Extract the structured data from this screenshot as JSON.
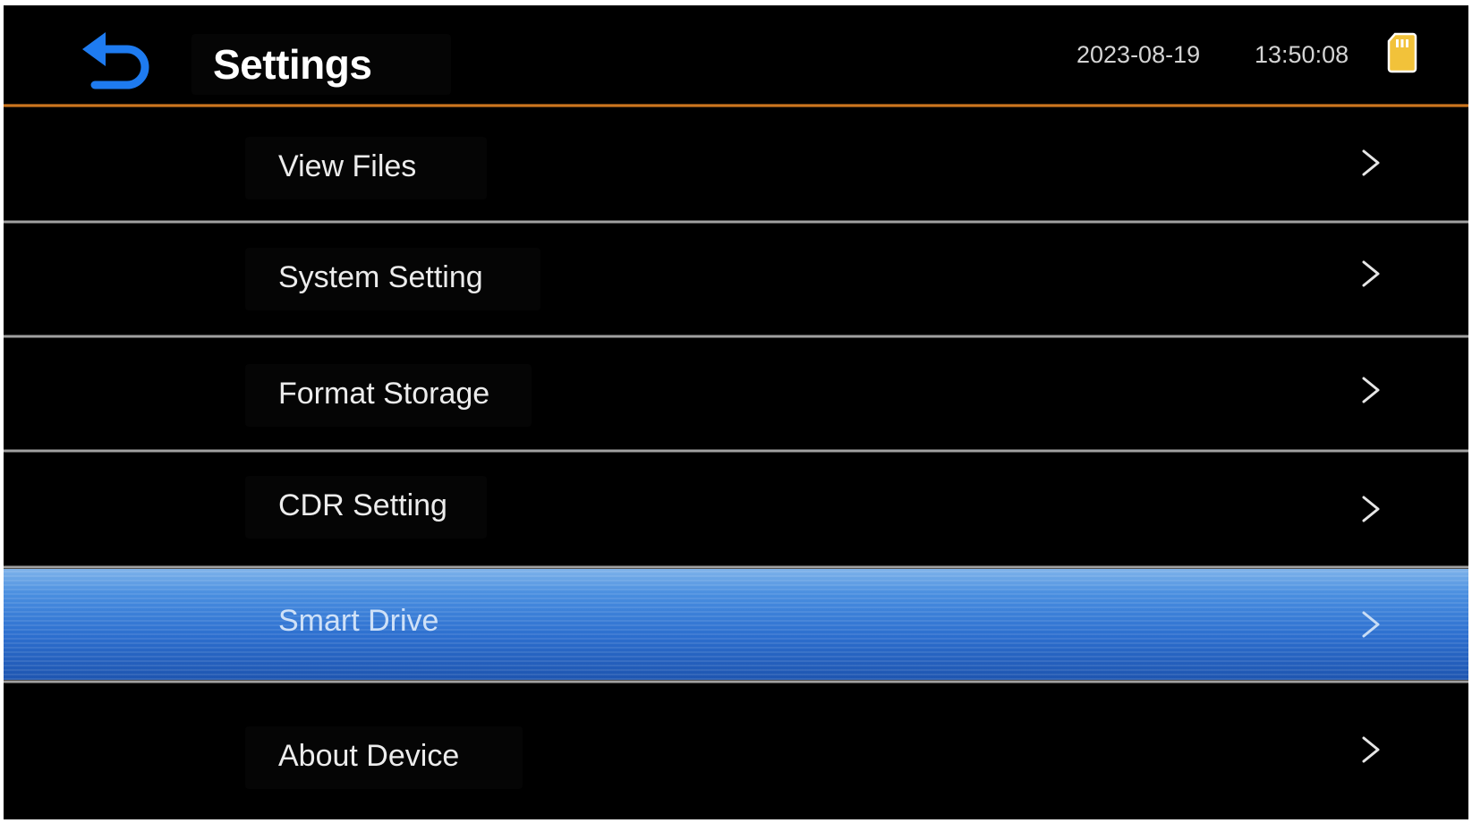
{
  "header": {
    "title": "Settings",
    "date": "2023-08-19",
    "time": "13:50:08",
    "back_icon": "back-arrow-icon",
    "storage_icon": "sd-card-icon"
  },
  "menu": {
    "items": [
      {
        "label": "View Files",
        "selected": false
      },
      {
        "label": "System Setting",
        "selected": false
      },
      {
        "label": "Format Storage",
        "selected": false
      },
      {
        "label": "CDR Setting",
        "selected": false
      },
      {
        "label": "Smart Drive",
        "selected": true
      },
      {
        "label": "About Device",
        "selected": false
      }
    ],
    "chevron_icon": "chevron-right-icon"
  },
  "colors": {
    "background": "#000000",
    "accent_rule": "#f18a22",
    "back_icon": "#1e7bf0",
    "selected_row": "#3a7fd8",
    "sd_card": "#f2c23a"
  }
}
